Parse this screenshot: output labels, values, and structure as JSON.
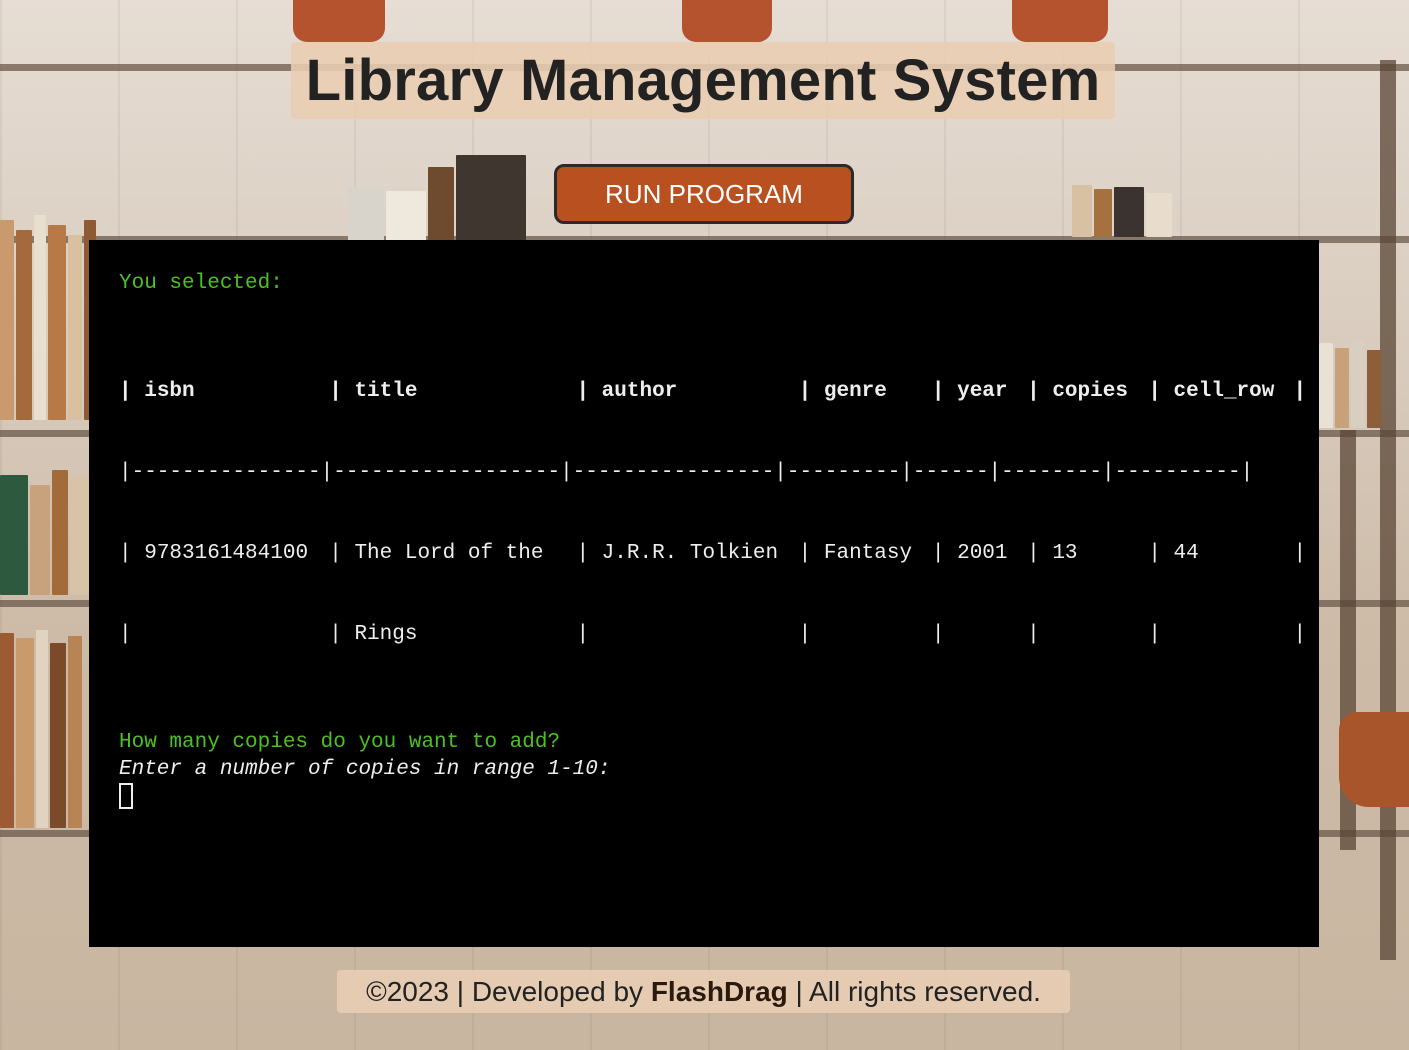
{
  "header": {
    "title": "Library Management System"
  },
  "controls": {
    "run_button": "RUN PROGRAM"
  },
  "terminal": {
    "selected_label": "You selected:",
    "table": {
      "columns": [
        "isbn",
        "title",
        "author",
        "genre",
        "year",
        "copies",
        "cell_row"
      ],
      "rows": [
        {
          "isbn": "9783161484100",
          "title_line1": "The Lord of the",
          "title_line2": "Rings",
          "author": "J.R.R. Tolkien",
          "genre": "Fantasy",
          "year": "2001",
          "copies": "13",
          "cell_row": "44"
        }
      ]
    },
    "prompt_question": "How many copies do you want to add?",
    "prompt_instruction": "Enter a number of copies in range 1-10:"
  },
  "footer": {
    "prefix": "©2023 | Developed by",
    "author": "FlashDrag",
    "suffix": "| All rights reserved."
  },
  "colors": {
    "prompt_green": "#4cc021",
    "button_bg": "#b9501f",
    "terminal_bg": "#000000",
    "title_bg": "#e8cdb2"
  }
}
